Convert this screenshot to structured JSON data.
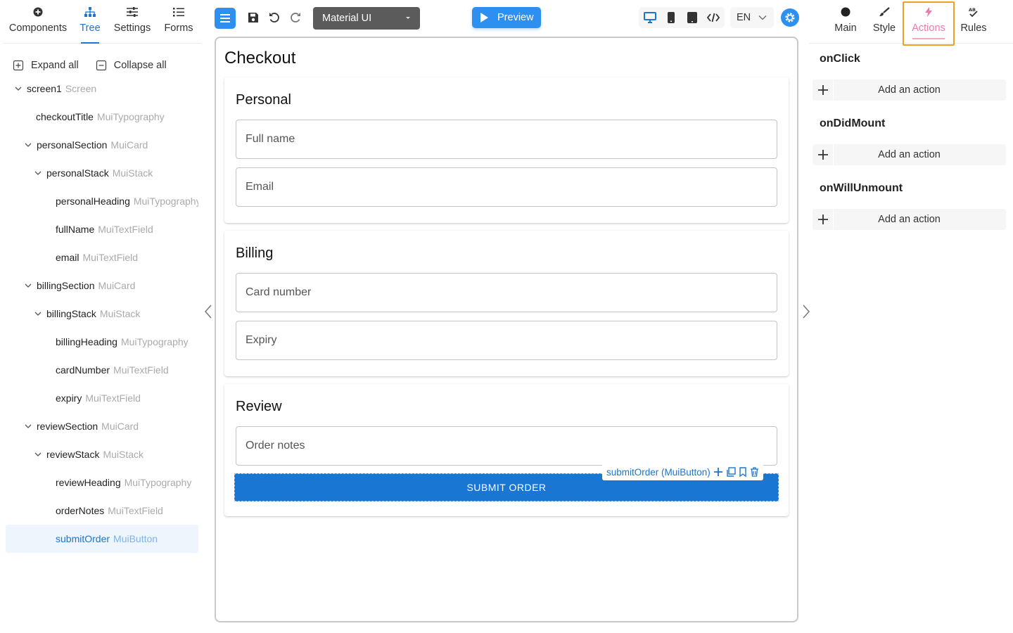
{
  "left_tabs": [
    {
      "label": "Components",
      "icon": "plus-circle-icon"
    },
    {
      "label": "Tree",
      "icon": "hierarchy-icon"
    },
    {
      "label": "Settings",
      "icon": "sliders-icon"
    },
    {
      "label": "Forms",
      "icon": "list-icon"
    }
  ],
  "tree_actions": {
    "expand": "Expand all",
    "collapse": "Collapse all"
  },
  "tree": [
    {
      "name": "screen1",
      "type": "Screen",
      "caret": true
    },
    {
      "name": "checkoutTitle",
      "type": "MuiTypography",
      "caret": false
    },
    {
      "name": "personalSection",
      "type": "MuiCard",
      "caret": true
    },
    {
      "name": "personalStack",
      "type": "MuiStack",
      "caret": true
    },
    {
      "name": "personalHeading",
      "type": "MuiTypography",
      "caret": false
    },
    {
      "name": "fullName",
      "type": "MuiTextField",
      "caret": false
    },
    {
      "name": "email",
      "type": "MuiTextField",
      "caret": false
    },
    {
      "name": "billingSection",
      "type": "MuiCard",
      "caret": true
    },
    {
      "name": "billingStack",
      "type": "MuiStack",
      "caret": true
    },
    {
      "name": "billingHeading",
      "type": "MuiTypography",
      "caret": false
    },
    {
      "name": "cardNumber",
      "type": "MuiTextField",
      "caret": false
    },
    {
      "name": "expiry",
      "type": "MuiTextField",
      "caret": false
    },
    {
      "name": "reviewSection",
      "type": "MuiCard",
      "caret": true
    },
    {
      "name": "reviewStack",
      "type": "MuiStack",
      "caret": true
    },
    {
      "name": "reviewHeading",
      "type": "MuiTypography",
      "caret": false
    },
    {
      "name": "orderNotes",
      "type": "MuiTextField",
      "caret": false
    },
    {
      "name": "submitOrder",
      "type": "MuiButton",
      "caret": false,
      "selected": true
    }
  ],
  "toolbar": {
    "library": "Material UI",
    "preview": "Preview",
    "language": "EN"
  },
  "canvas": {
    "title": "Checkout",
    "personal": {
      "heading": "Personal",
      "full_name": "Full name",
      "email": "Email"
    },
    "billing": {
      "heading": "Billing",
      "card_number": "Card number",
      "expiry": "Expiry"
    },
    "review": {
      "heading": "Review",
      "order_notes": "Order notes",
      "submit": "SUBMIT ORDER"
    },
    "selection_label": "submitOrder (MuiButton)"
  },
  "right_tabs": [
    {
      "label": "Main",
      "icon": "circle-icon"
    },
    {
      "label": "Style",
      "icon": "brush-icon"
    },
    {
      "label": "Actions",
      "icon": "lightning-icon",
      "active": true
    },
    {
      "label": "Rules",
      "icon": "spellcheck-icon"
    }
  ],
  "events": [
    {
      "name": "onClick",
      "add": "Add an action"
    },
    {
      "name": "onDidMount",
      "add": "Add an action"
    },
    {
      "name": "onWillUnmount",
      "add": "Add an action"
    }
  ],
  "colors": {
    "primary": "#1976d2",
    "accent": "#2d8ff0",
    "actions_tab": "#e97ba6",
    "highlight": "#f0a020"
  }
}
